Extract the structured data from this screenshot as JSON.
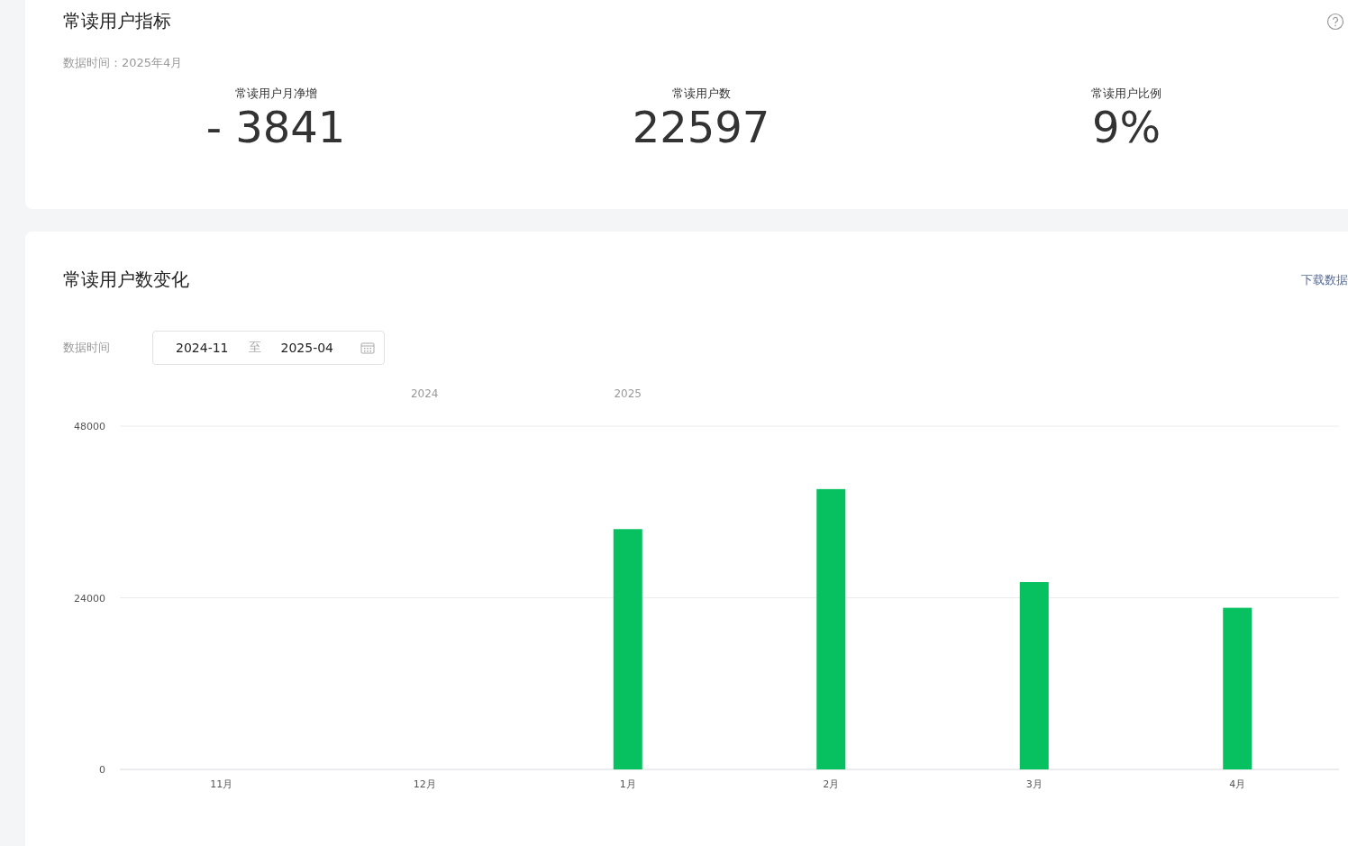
{
  "overview": {
    "title": "常读用户指标",
    "data_time": "数据时间：2025年4月",
    "metrics": [
      {
        "label": "常读用户月净增",
        "value": "- 3841"
      },
      {
        "label": "常读用户数",
        "value": "22597"
      },
      {
        "label": "常读用户比例",
        "value": "9%"
      }
    ]
  },
  "trend": {
    "title": "常读用户数变化",
    "download_link": "下载数据",
    "filter_label": "数据时间",
    "date_range": {
      "start": "2024-11",
      "separator": "至",
      "end": "2025-04"
    },
    "chart_data": {
      "type": "bar",
      "categories": [
        "11月",
        "12月",
        "1月",
        "2月",
        "3月",
        "4月"
      ],
      "series": [
        {
          "color": "#07c160",
          "values": [
            null,
            null,
            33600,
            39200,
            26200,
            22600
          ]
        }
      ],
      "ylim": [
        0,
        48000
      ],
      "yticks": [
        0,
        24000,
        48000
      ]
    },
    "year_labels": [
      "2024",
      "2025"
    ]
  }
}
